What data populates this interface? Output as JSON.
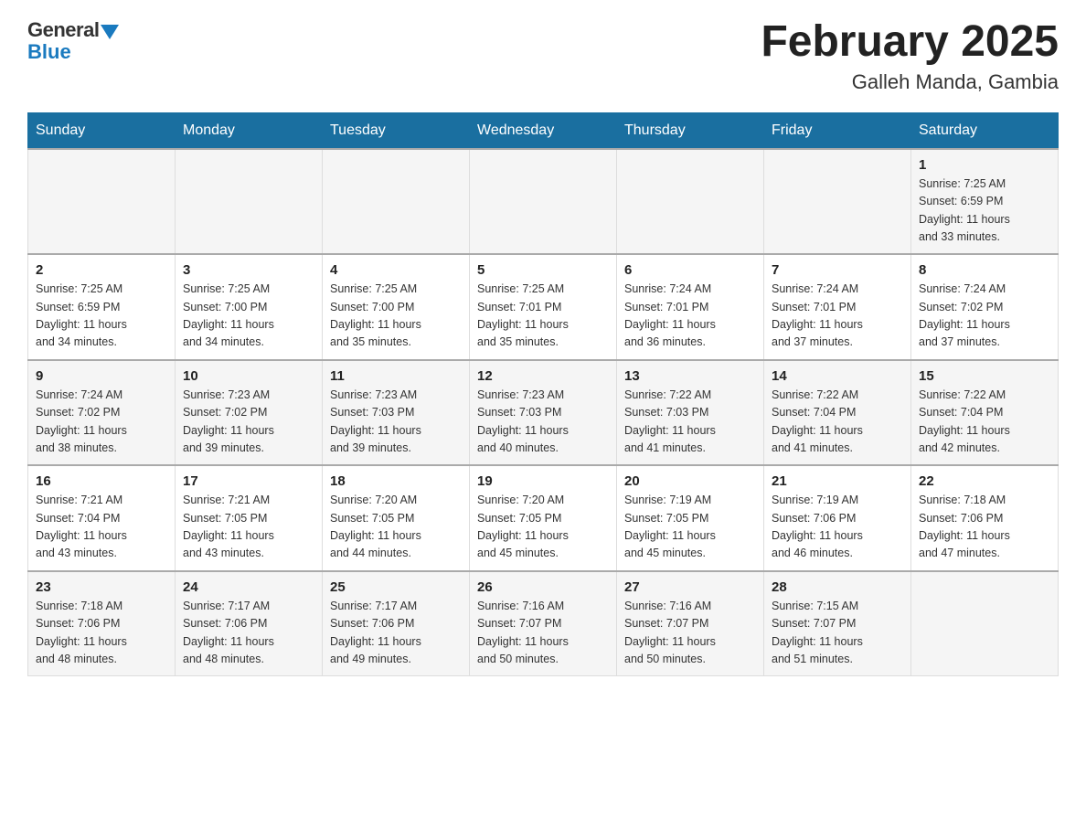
{
  "header": {
    "logo_general": "General",
    "logo_blue": "Blue",
    "month_title": "February 2025",
    "location": "Galleh Manda, Gambia"
  },
  "days_of_week": [
    "Sunday",
    "Monday",
    "Tuesday",
    "Wednesday",
    "Thursday",
    "Friday",
    "Saturday"
  ],
  "weeks": [
    {
      "days": [
        {
          "num": "",
          "info": ""
        },
        {
          "num": "",
          "info": ""
        },
        {
          "num": "",
          "info": ""
        },
        {
          "num": "",
          "info": ""
        },
        {
          "num": "",
          "info": ""
        },
        {
          "num": "",
          "info": ""
        },
        {
          "num": "1",
          "info": "Sunrise: 7:25 AM\nSunset: 6:59 PM\nDaylight: 11 hours\nand 33 minutes."
        }
      ]
    },
    {
      "days": [
        {
          "num": "2",
          "info": "Sunrise: 7:25 AM\nSunset: 6:59 PM\nDaylight: 11 hours\nand 34 minutes."
        },
        {
          "num": "3",
          "info": "Sunrise: 7:25 AM\nSunset: 7:00 PM\nDaylight: 11 hours\nand 34 minutes."
        },
        {
          "num": "4",
          "info": "Sunrise: 7:25 AM\nSunset: 7:00 PM\nDaylight: 11 hours\nand 35 minutes."
        },
        {
          "num": "5",
          "info": "Sunrise: 7:25 AM\nSunset: 7:01 PM\nDaylight: 11 hours\nand 35 minutes."
        },
        {
          "num": "6",
          "info": "Sunrise: 7:24 AM\nSunset: 7:01 PM\nDaylight: 11 hours\nand 36 minutes."
        },
        {
          "num": "7",
          "info": "Sunrise: 7:24 AM\nSunset: 7:01 PM\nDaylight: 11 hours\nand 37 minutes."
        },
        {
          "num": "8",
          "info": "Sunrise: 7:24 AM\nSunset: 7:02 PM\nDaylight: 11 hours\nand 37 minutes."
        }
      ]
    },
    {
      "days": [
        {
          "num": "9",
          "info": "Sunrise: 7:24 AM\nSunset: 7:02 PM\nDaylight: 11 hours\nand 38 minutes."
        },
        {
          "num": "10",
          "info": "Sunrise: 7:23 AM\nSunset: 7:02 PM\nDaylight: 11 hours\nand 39 minutes."
        },
        {
          "num": "11",
          "info": "Sunrise: 7:23 AM\nSunset: 7:03 PM\nDaylight: 11 hours\nand 39 minutes."
        },
        {
          "num": "12",
          "info": "Sunrise: 7:23 AM\nSunset: 7:03 PM\nDaylight: 11 hours\nand 40 minutes."
        },
        {
          "num": "13",
          "info": "Sunrise: 7:22 AM\nSunset: 7:03 PM\nDaylight: 11 hours\nand 41 minutes."
        },
        {
          "num": "14",
          "info": "Sunrise: 7:22 AM\nSunset: 7:04 PM\nDaylight: 11 hours\nand 41 minutes."
        },
        {
          "num": "15",
          "info": "Sunrise: 7:22 AM\nSunset: 7:04 PM\nDaylight: 11 hours\nand 42 minutes."
        }
      ]
    },
    {
      "days": [
        {
          "num": "16",
          "info": "Sunrise: 7:21 AM\nSunset: 7:04 PM\nDaylight: 11 hours\nand 43 minutes."
        },
        {
          "num": "17",
          "info": "Sunrise: 7:21 AM\nSunset: 7:05 PM\nDaylight: 11 hours\nand 43 minutes."
        },
        {
          "num": "18",
          "info": "Sunrise: 7:20 AM\nSunset: 7:05 PM\nDaylight: 11 hours\nand 44 minutes."
        },
        {
          "num": "19",
          "info": "Sunrise: 7:20 AM\nSunset: 7:05 PM\nDaylight: 11 hours\nand 45 minutes."
        },
        {
          "num": "20",
          "info": "Sunrise: 7:19 AM\nSunset: 7:05 PM\nDaylight: 11 hours\nand 45 minutes."
        },
        {
          "num": "21",
          "info": "Sunrise: 7:19 AM\nSunset: 7:06 PM\nDaylight: 11 hours\nand 46 minutes."
        },
        {
          "num": "22",
          "info": "Sunrise: 7:18 AM\nSunset: 7:06 PM\nDaylight: 11 hours\nand 47 minutes."
        }
      ]
    },
    {
      "days": [
        {
          "num": "23",
          "info": "Sunrise: 7:18 AM\nSunset: 7:06 PM\nDaylight: 11 hours\nand 48 minutes."
        },
        {
          "num": "24",
          "info": "Sunrise: 7:17 AM\nSunset: 7:06 PM\nDaylight: 11 hours\nand 48 minutes."
        },
        {
          "num": "25",
          "info": "Sunrise: 7:17 AM\nSunset: 7:06 PM\nDaylight: 11 hours\nand 49 minutes."
        },
        {
          "num": "26",
          "info": "Sunrise: 7:16 AM\nSunset: 7:07 PM\nDaylight: 11 hours\nand 50 minutes."
        },
        {
          "num": "27",
          "info": "Sunrise: 7:16 AM\nSunset: 7:07 PM\nDaylight: 11 hours\nand 50 minutes."
        },
        {
          "num": "28",
          "info": "Sunrise: 7:15 AM\nSunset: 7:07 PM\nDaylight: 11 hours\nand 51 minutes."
        },
        {
          "num": "",
          "info": ""
        }
      ]
    }
  ]
}
